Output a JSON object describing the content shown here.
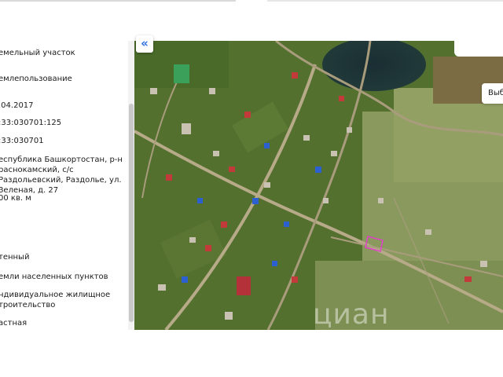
{
  "panel": {
    "type_value": "емельный участок",
    "usage_value": "емлепользование",
    "date_value": ".04.2017",
    "cadastral_number": ":33:030701:125",
    "cadastral_quarter": ":33:030701",
    "address": "еспублика Башкортостан, р-н раснокамский, с/с Раздольевский, Раздолье, ул. Зеленая, д. 27",
    "area": "00 кв. м",
    "status": "тенный",
    "land_category": "емли населенных пунктов",
    "permitted_use": "ндивидуальное жилищное троительство",
    "ownership": "астная"
  },
  "map": {
    "collapse_label": "«",
    "select_label": "Выб",
    "watermark": "циан"
  }
}
